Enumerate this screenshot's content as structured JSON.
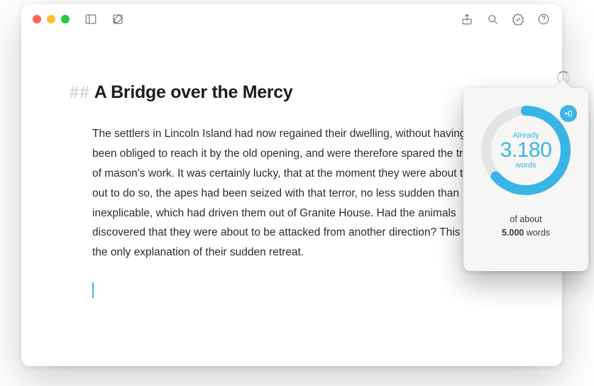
{
  "toolbar": {
    "icons": {
      "sidebar": "sidebar-icon",
      "compose": "compose-icon",
      "share": "share-icon",
      "search": "search-icon",
      "goal": "goal-badge-icon",
      "help": "help-icon"
    }
  },
  "editor": {
    "heading_marker": "##",
    "heading": "A Bridge over the Mercy",
    "body": "The settlers in Lincoln Island had now regained their dwelling, without having been obliged to reach it by the old opening, and were therefore spared the trouble of mason's work. It was certainly lucky, that at the moment they were about to set out to do so, the apes had been seized with that terror, no less sudden than inexplicable, which had driven them out of Granite House. Had the animals discovered that they were about to be attacked from another direction? This was the only explanation of their sudden retreat."
  },
  "goal_popover": {
    "already_label": "Already",
    "count": "3.180",
    "unit": "words",
    "of_about": "of about",
    "target": "5.000",
    "target_unit": "words",
    "progress_fraction": 0.636
  }
}
